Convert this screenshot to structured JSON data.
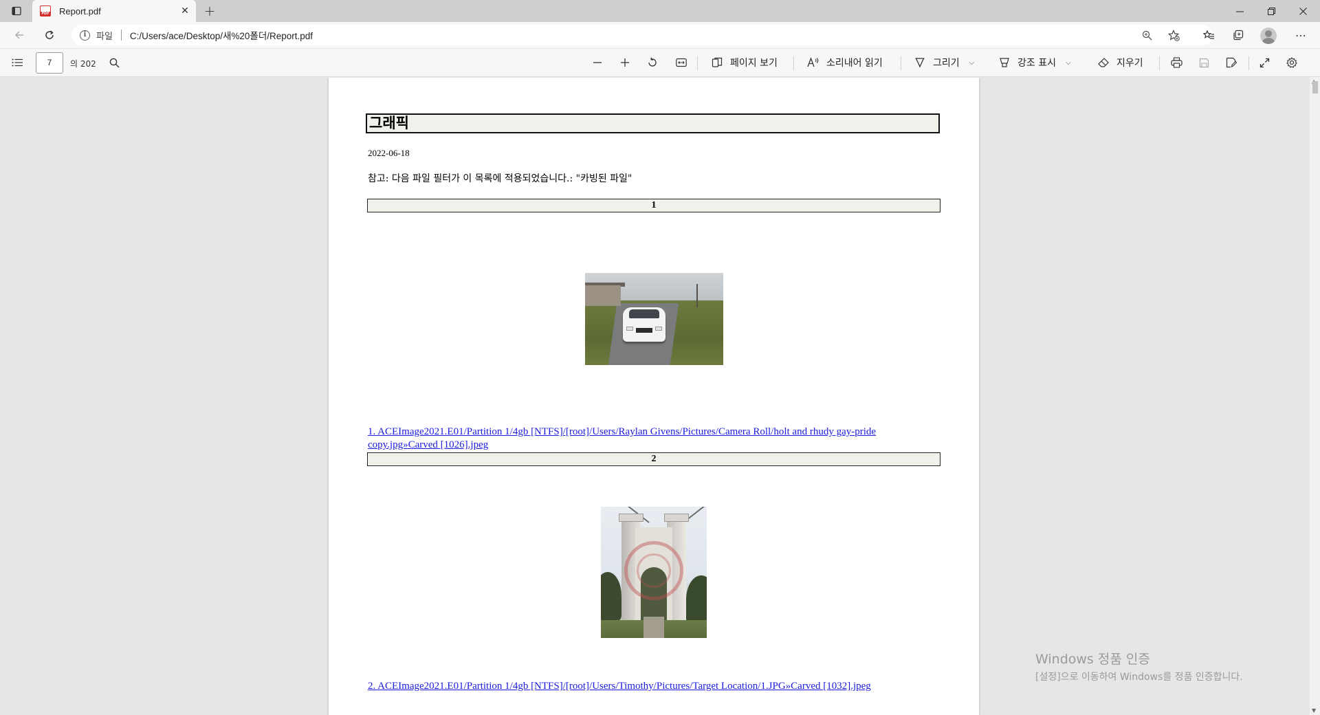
{
  "browser": {
    "tab": {
      "title": "Report.pdf"
    },
    "address": {
      "scheme_label": "파일",
      "url": "C:/Users/ace/Desktop/새%20폴더/Report.pdf"
    }
  },
  "pdf_toolbar": {
    "current_page": "7",
    "page_total": "의 202",
    "page_view_label": "페이지 보기",
    "read_aloud_label": "소리내어 읽기",
    "draw_label": "그리기",
    "highlight_label": "강조 표시",
    "erase_label": "지우기"
  },
  "document": {
    "heading": "그래픽",
    "date": "2022-06-18",
    "note": "참고: 다음 파일 필터가 이 목록에 적용되었습니다.: \"카빙된 파일\"",
    "records": [
      {
        "number": "1",
        "link_line1": "1. ACEImage2021.E01/Partition 1/4gb [NTFS]/[root]/Users/Raylan Givens/Pictures/Camera Roll/holt and rhudy gay-pride",
        "link_line2": "copy.jpg»Carved [1026].jpeg"
      },
      {
        "number": "2",
        "link_line1": "2. ACEImage2021.E01/Partition 1/4gb [NTFS]/[root]/Users/Timothy/Pictures/Target Location/1.JPG»Carved [1032].jpeg",
        "link_line2": ""
      }
    ]
  },
  "watermark": {
    "title": "Windows 정품 인증",
    "subtitle": "[설정]으로 이동하여 Windows를 정품 인증합니다."
  },
  "colors": {
    "link": "#1a1adf",
    "record_header_bg": "#f2f0ea",
    "pdf_icon": "#d32f2f"
  }
}
